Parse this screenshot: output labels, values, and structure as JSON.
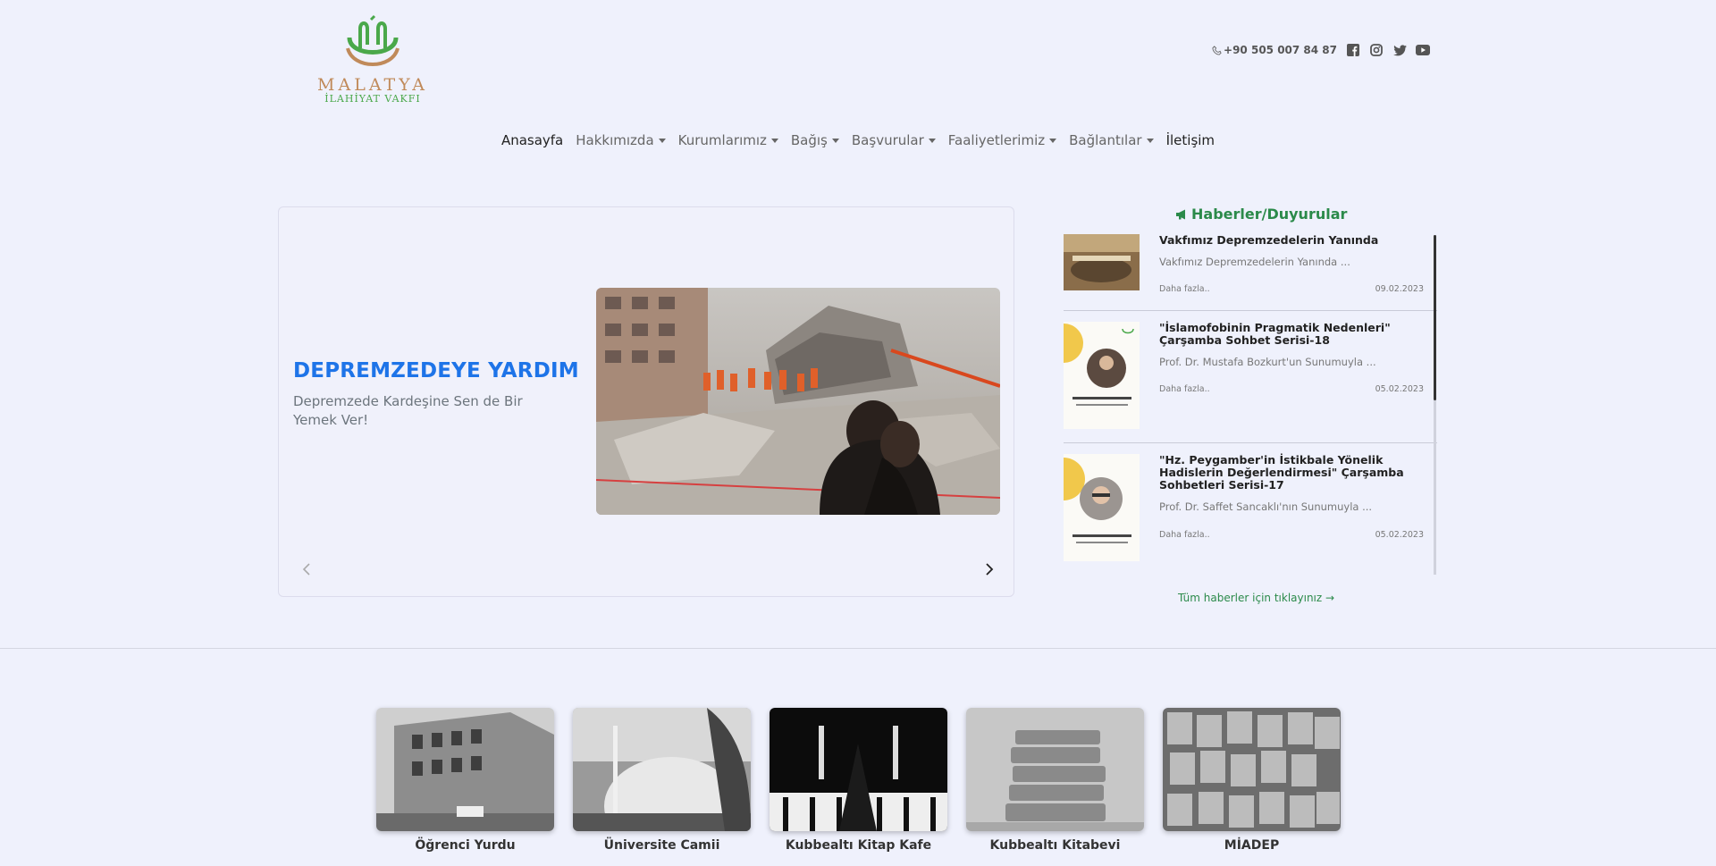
{
  "header": {
    "logo_name": "MALATYA",
    "logo_sub": "İLAHİYAT VAKFI",
    "phone": "+90 505 007 84 87",
    "social": [
      "facebook-icon",
      "instagram-icon",
      "twitter-icon",
      "youtube-icon"
    ]
  },
  "nav": {
    "items": [
      {
        "label": "Anasayfa"
      },
      {
        "label": "Hakkımızda"
      },
      {
        "label": "Kurumlarımız"
      },
      {
        "label": "Bağış"
      },
      {
        "label": "Başvurular"
      },
      {
        "label": "Faaliyetlerimiz"
      },
      {
        "label": "Bağlantılar"
      },
      {
        "label": "İletişim"
      }
    ]
  },
  "slider": {
    "title": "DEPREMZEDEYE YARDIM",
    "desc": "Depremzede Kardeşine Sen de Bir Yemek Ver!"
  },
  "news": {
    "title": "Haberler/Duyurular",
    "more_label": "Daha fazla..",
    "items": [
      {
        "title": "Vakfımız Depremzedelerin Yanında",
        "summary": "Vakfımız Depremzedelerin Yanında ...",
        "date": "09.02.2023"
      },
      {
        "title": "\"İslamofobinin Pragmatik Nedenleri\" Çarşamba Sohbet Serisi-18",
        "summary": "Prof. Dr. Mustafa Bozkurt'un Sunumuyla ...",
        "date": "05.02.2023"
      },
      {
        "title": "\"Hz. Peygamber'in İstikbale Yönelik Hadislerin Değerlendirmesi\" Çarşamba Sohbetleri Serisi-17",
        "summary": "Prof. Dr. Saffet Sancaklı'nın Sunumuyla ...",
        "date": "05.02.2023"
      }
    ],
    "all_label": "Tüm haberler için tıklayınız →"
  },
  "institutions": [
    {
      "label": "Öğrenci Yurdu"
    },
    {
      "label": "Üniversite Camii"
    },
    {
      "label": "Kubbealtı Kitap Kafe"
    },
    {
      "label": "Kubbealtı Kitabevi"
    },
    {
      "label": "MİADEP"
    }
  ],
  "colors": {
    "background": "#eff1fc",
    "accent_blue": "#1e74e8",
    "accent_green": "#2b8a4a"
  }
}
